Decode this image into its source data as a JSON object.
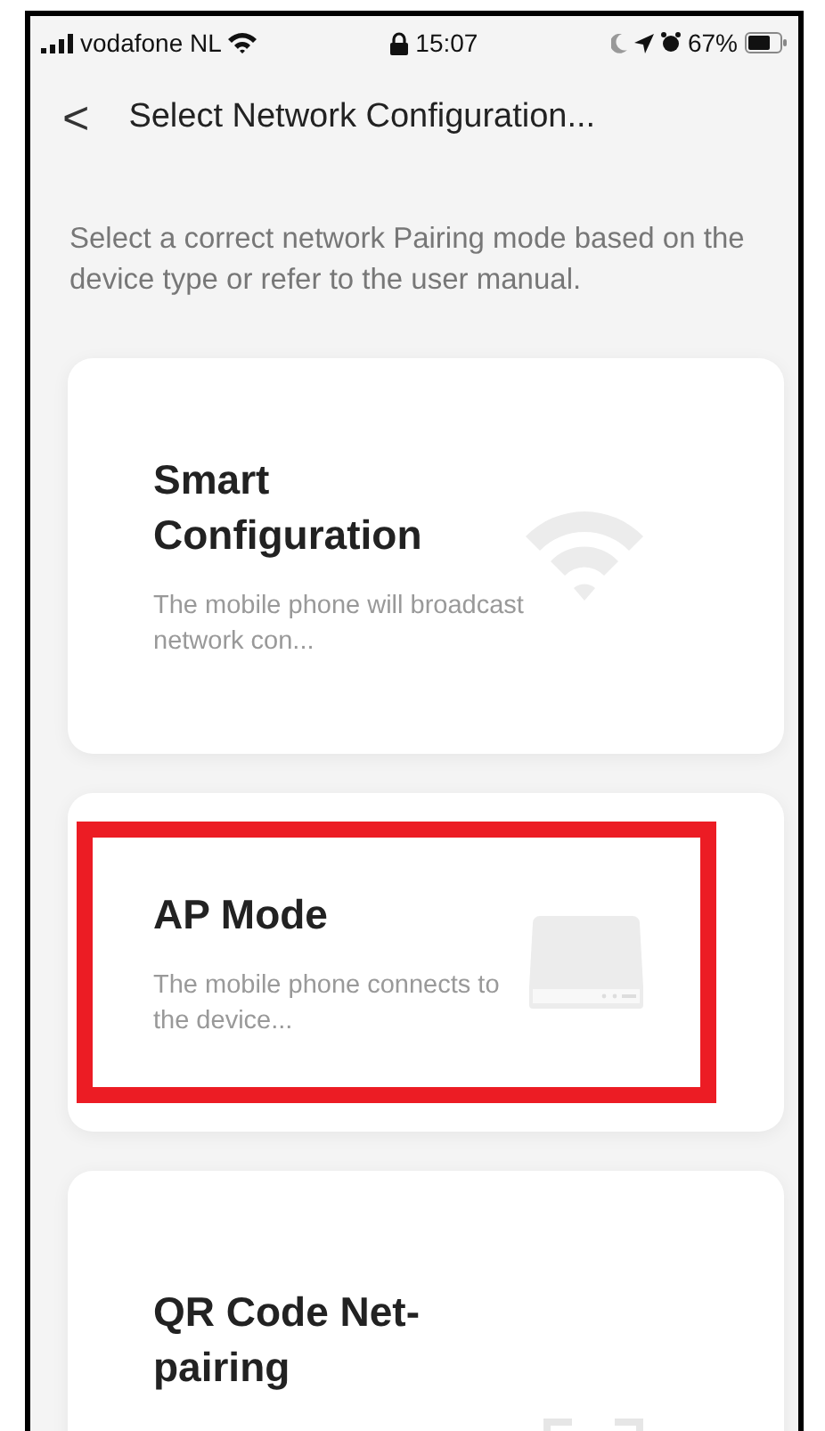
{
  "status_bar": {
    "carrier": "vodafone NL",
    "time": "15:07",
    "battery": "67%"
  },
  "nav": {
    "back": "<",
    "title": "Select Network Configuration..."
  },
  "description": "Select a correct network Pairing mode based on the device type or refer to the user manual.",
  "modes": [
    {
      "kind": "wifi",
      "title": "Smart Configuration",
      "subtitle": "The mobile phone will broadcast network con...",
      "highlighted": false
    },
    {
      "kind": "device",
      "title": "AP Mode",
      "subtitle": "The mobile phone connects to the device...",
      "highlighted": true
    },
    {
      "kind": "scan",
      "title": "QR Code Net-pairing",
      "highlighted": false
    }
  ]
}
